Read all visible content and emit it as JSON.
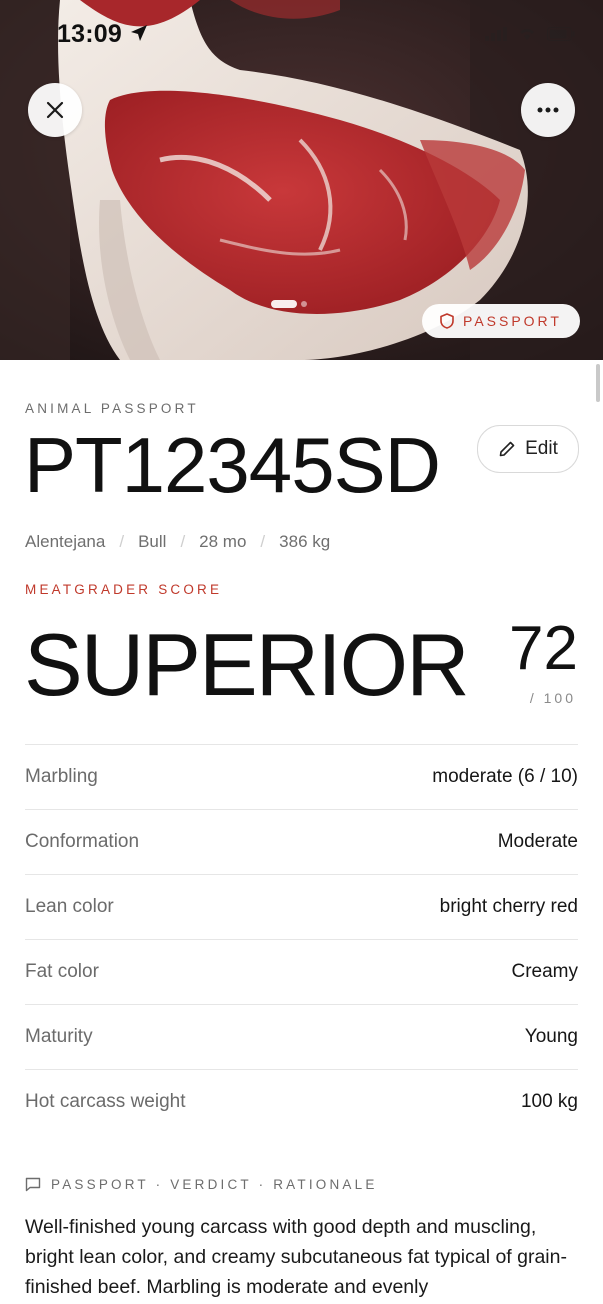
{
  "status_bar": {
    "time": "13:09"
  },
  "hero": {
    "close_icon": "close-icon",
    "more_icon": "more-horizontal-icon",
    "badge_label": "PASSPORT",
    "badge_icon": "shield-icon",
    "accent_color": "#c0392b"
  },
  "passport": {
    "eyebrow": "ANIMAL PASSPORT",
    "id": "PT12345SD",
    "edit_label": "Edit",
    "meta": {
      "breed": "Alentejana",
      "sex": "Bull",
      "age": "28 mo",
      "weight": "386 kg"
    }
  },
  "score": {
    "eyebrow": "MEATGRADER SCORE",
    "grade": "SUPERIOR",
    "value": "72",
    "max": "/ 100"
  },
  "attributes": [
    {
      "label": "Marbling",
      "value": "moderate (6 / 10)"
    },
    {
      "label": "Conformation",
      "value": "Moderate"
    },
    {
      "label": "Lean color",
      "value": "bright cherry red"
    },
    {
      "label": "Fat color",
      "value": "Creamy"
    },
    {
      "label": "Maturity",
      "value": "Young"
    },
    {
      "label": "Hot carcass weight",
      "value": "100 kg"
    }
  ],
  "rationale": {
    "heading": "PASSPORT · VERDICT · RATIONALE",
    "icon": "comment-icon",
    "text": "Well-finished young carcass with good depth and muscling, bright lean color, and creamy subcutaneous fat typical of grain-finished beef. Marbling is moderate and evenly"
  }
}
